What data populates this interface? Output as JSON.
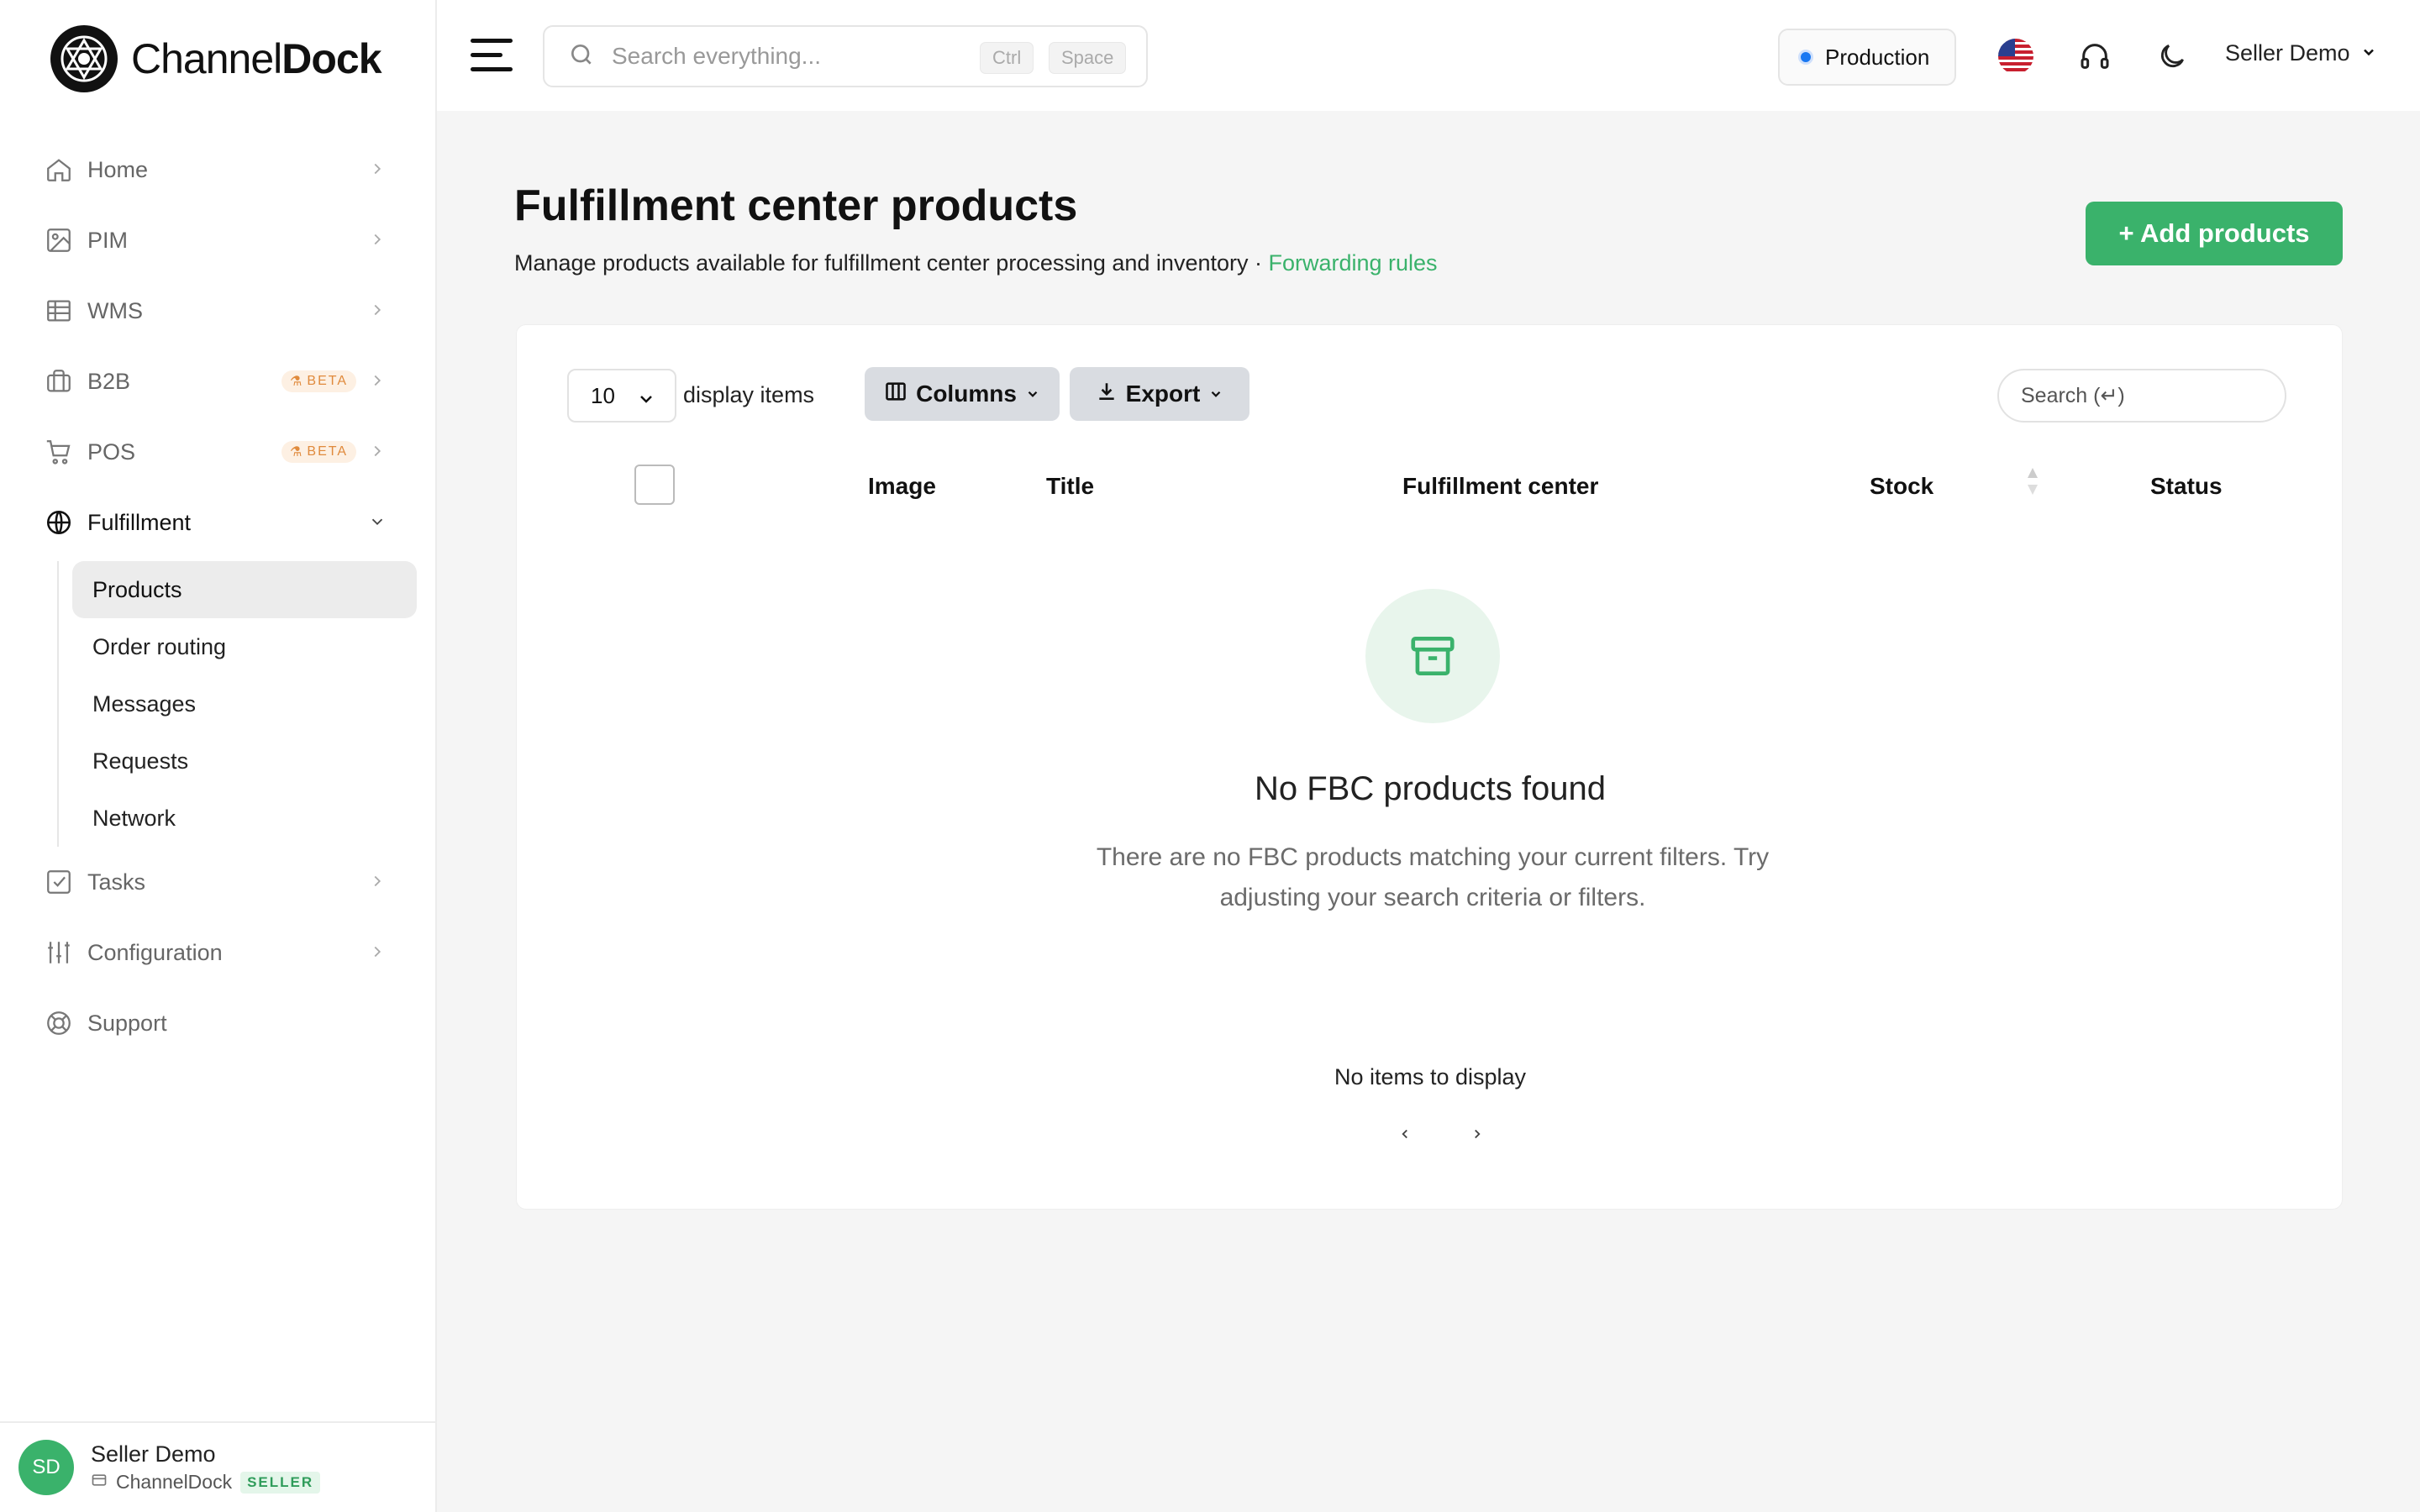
{
  "brand": {
    "name_regular": "Channel",
    "name_bold": "Dock"
  },
  "topbar": {
    "search_placeholder": "Search everything...",
    "kbd_ctrl": "Ctrl",
    "kbd_space": "Space",
    "environment": "Production",
    "environment_color": "#1877f2",
    "user_menu": "Seller Demo"
  },
  "sidebar": {
    "items": [
      {
        "label": "Home",
        "icon": "home-icon"
      },
      {
        "label": "PIM",
        "icon": "image-icon"
      },
      {
        "label": "WMS",
        "icon": "table-icon"
      },
      {
        "label": "B2B",
        "icon": "briefcase-icon",
        "badge": "BETA"
      },
      {
        "label": "POS",
        "icon": "cart-icon",
        "badge": "BETA"
      },
      {
        "label": "Fulfillment",
        "icon": "globe-icon"
      },
      {
        "label": "Tasks",
        "icon": "checkbox-icon"
      },
      {
        "label": "Configuration",
        "icon": "sliders-icon"
      },
      {
        "label": "Support",
        "icon": "lifebuoy-icon"
      }
    ],
    "fulfillment_sub": [
      {
        "label": "Products"
      },
      {
        "label": "Order routing"
      },
      {
        "label": "Messages"
      },
      {
        "label": "Requests"
      },
      {
        "label": "Network"
      }
    ],
    "user": {
      "initials": "SD",
      "name": "Seller Demo",
      "org": "ChannelDock",
      "role": "SELLER"
    }
  },
  "main": {
    "title": "Fulfillment center products",
    "subtitle": "Manage products available for fulfillment center processing and inventory · ",
    "subtitle_link": "Forwarding rules",
    "add_button": "+ Add products",
    "accent_color": "#3ab26b"
  },
  "table": {
    "page_size": "10",
    "display_label": "display items",
    "columns_button": "Columns",
    "export_button": "Export",
    "search_placeholder": "Search (↵)",
    "headers": [
      "Image",
      "Title",
      "Fulfillment center",
      "Stock",
      "Status"
    ],
    "empty_title": "No FBC products found",
    "empty_desc": "There are no FBC products matching your current filters. Try adjusting your search criteria or filters.",
    "no_items": "No items to display"
  }
}
